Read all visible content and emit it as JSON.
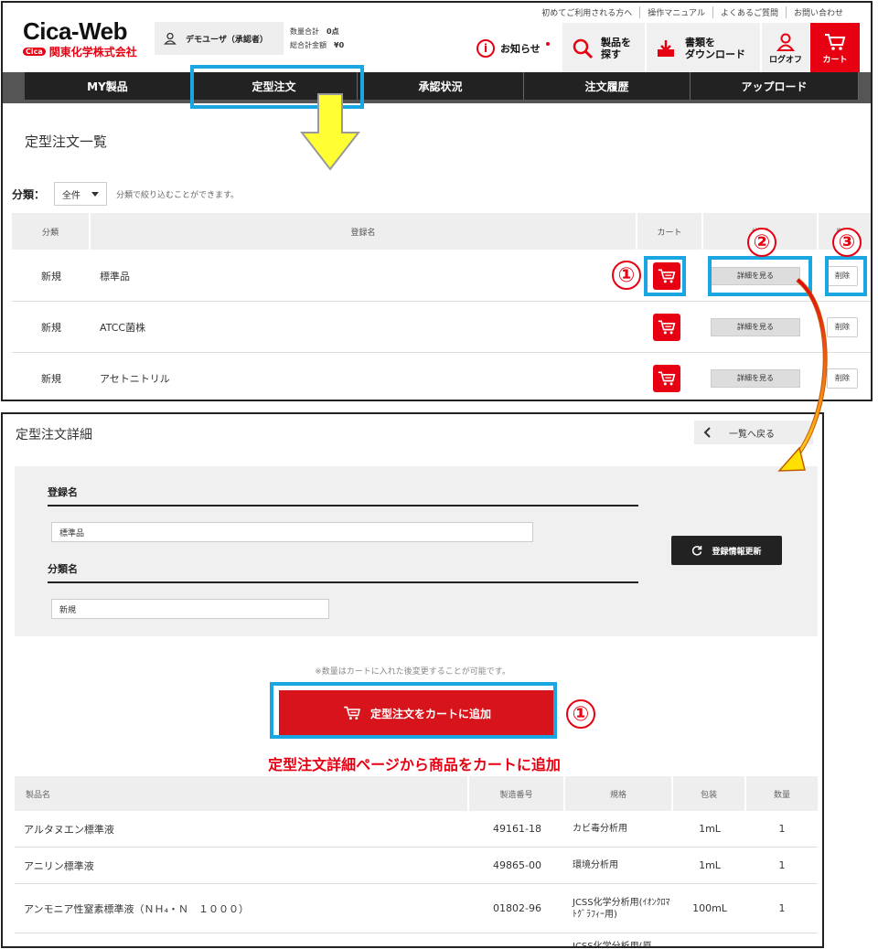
{
  "header": {
    "top_links": [
      "初めてご利用される方へ",
      "操作マニュアル",
      "よくあるご質問",
      "お問い合わせ"
    ],
    "logo_main": "Cica-Web",
    "logo_badge": "Cica",
    "logo_company": "関東化学株式会社",
    "user_name": "デモユーザ（承認者）",
    "qty_total_label": "数量合計",
    "qty_total_value": "0点",
    "amount_total_label": "総合計金額",
    "amount_total_value": "¥0",
    "notice_label": "お知らせ",
    "search_label_1": "製品を",
    "search_label_2": "探す",
    "download_label_1": "書類を",
    "download_label_2": "ダウンロード",
    "logout_label": "ログオフ",
    "cart_label": "カート"
  },
  "nav": {
    "items": [
      "MY製品",
      "定型注文",
      "承認状況",
      "注文履歴",
      "アップロード"
    ]
  },
  "list": {
    "title": "定型注文一覧",
    "filter_label": "分類：",
    "filter_value": "全件",
    "filter_note": "分類で絞り込むことができます。",
    "headers": {
      "category": "分類",
      "name": "登録名",
      "cart": "カート",
      "detail": "詳細",
      "delete": "削除"
    },
    "rows": [
      {
        "category": "新規",
        "name": "標準品",
        "detail": "詳細を見る",
        "delete": "削除"
      },
      {
        "category": "新規",
        "name": "ATCC菌株",
        "detail": "詳細を見る",
        "delete": "削除"
      },
      {
        "category": "新規",
        "name": "アセトニトリル",
        "detail": "詳細を見る",
        "delete": "削除"
      }
    ]
  },
  "annotations": {
    "one": "①",
    "two": "②",
    "three": "③"
  },
  "detail": {
    "title": "定型注文詳細",
    "back_label": "一覧へ戻る",
    "reg_name_label": "登録名",
    "reg_name_value": "標準品",
    "cat_name_label": "分類名",
    "cat_name_value": "新規",
    "refresh_label": "登録情報更新",
    "qty_note": "※数量はカートに入れた後変更することが可能です。",
    "add_cart_label": "定型注文をカートに追加",
    "caption": "定型注文詳細ページから商品をカートに追加",
    "headers": {
      "name": "製品名",
      "code": "製造番号",
      "spec": "規格",
      "pack": "包装",
      "qty": "数量"
    },
    "rows": [
      {
        "name": "アルタヌエン標準液",
        "code": "49161-18",
        "spec": "カビ毒分析用",
        "pack": "1mL",
        "qty": "1"
      },
      {
        "name": "アニリン標準液",
        "code": "49865-00",
        "spec": "環境分析用",
        "pack": "1mL",
        "qty": "1"
      },
      {
        "name": "アンモニア性窒素標準液（ＮＨ₄・Ｎ　１０００）",
        "code": "01802-96",
        "spec": "JCSS化学分析用(ｲｵﾝｸﾛﾏﾄｸﾞﾗﾌｨｰ用)",
        "pack": "100mL",
        "qty": "1"
      },
      {
        "name": "",
        "code": "",
        "spec": "JCSS化学分析用(原",
        "pack": "",
        "qty": ""
      }
    ]
  },
  "colors": {
    "brand_red": "#e60012",
    "highlight_blue": "#1aa6e0",
    "nav_dark": "#222222"
  }
}
